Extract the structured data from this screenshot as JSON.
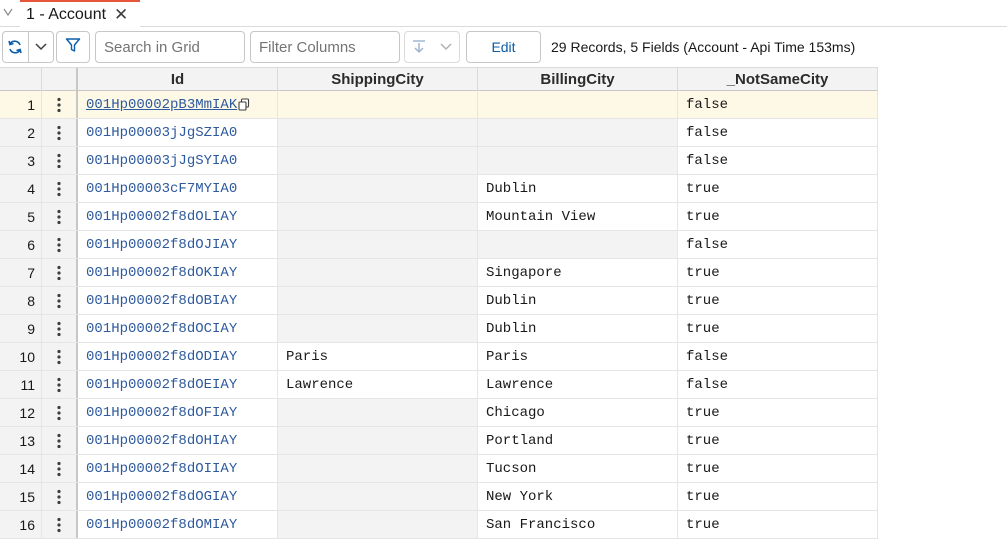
{
  "tabs": [
    {
      "label": "1 - Account",
      "close_glyph": "✕"
    }
  ],
  "toolbar": {
    "search_placeholder": "Search in Grid",
    "filter_placeholder": "Filter Columns",
    "edit_label": "Edit",
    "status": "29 Records, 5 Fields (Account - Api Time 153ms)"
  },
  "colors": {
    "accent": "#0b5cab",
    "tab_indicator": "#e8563a",
    "link": "#2e5a9e",
    "selected_row": "#fef9e6"
  },
  "icons": [
    "collapse-icon",
    "refresh-icon",
    "chevron-down-icon",
    "filter-icon",
    "export-icon",
    "row-menu-icon",
    "copy-icon",
    "close-icon"
  ],
  "grid": {
    "columns": [
      "",
      "",
      "Id",
      "ShippingCity",
      "BillingCity",
      "_NotSameCity"
    ],
    "rows": [
      {
        "num": "1",
        "id": "001Hp00002pB3MmIAK",
        "shipping": "",
        "billing": "",
        "not_same": "false"
      },
      {
        "num": "2",
        "id": "001Hp00003jJgSZIA0",
        "shipping": "",
        "billing": "",
        "not_same": "false"
      },
      {
        "num": "3",
        "id": "001Hp00003jJgSYIA0",
        "shipping": "",
        "billing": "",
        "not_same": "false"
      },
      {
        "num": "4",
        "id": "001Hp00003cF7MYIA0",
        "shipping": "",
        "billing": "Dublin",
        "not_same": "true"
      },
      {
        "num": "5",
        "id": "001Hp00002f8dOLIAY",
        "shipping": "",
        "billing": "Mountain View",
        "not_same": "true"
      },
      {
        "num": "6",
        "id": "001Hp00002f8dOJIAY",
        "shipping": "",
        "billing": "",
        "not_same": "false"
      },
      {
        "num": "7",
        "id": "001Hp00002f8dOKIAY",
        "shipping": "",
        "billing": "Singapore",
        "not_same": "true"
      },
      {
        "num": "8",
        "id": "001Hp00002f8dOBIAY",
        "shipping": "",
        "billing": "Dublin",
        "not_same": "true"
      },
      {
        "num": "9",
        "id": "001Hp00002f8dOCIAY",
        "shipping": "",
        "billing": "Dublin",
        "not_same": "true"
      },
      {
        "num": "10",
        "id": "001Hp00002f8dODIAY",
        "shipping": "Paris",
        "billing": "Paris",
        "not_same": "false"
      },
      {
        "num": "11",
        "id": "001Hp00002f8dOEIAY",
        "shipping": "Lawrence",
        "billing": "Lawrence",
        "not_same": "false"
      },
      {
        "num": "12",
        "id": "001Hp00002f8dOFIAY",
        "shipping": "",
        "billing": "Chicago",
        "not_same": "true"
      },
      {
        "num": "13",
        "id": "001Hp00002f8dOHIAY",
        "shipping": "",
        "billing": "Portland",
        "not_same": "true"
      },
      {
        "num": "14",
        "id": "001Hp00002f8dOIIAY",
        "shipping": "",
        "billing": "Tucson",
        "not_same": "true"
      },
      {
        "num": "15",
        "id": "001Hp00002f8dOGIAY",
        "shipping": "",
        "billing": "New York",
        "not_same": "true"
      },
      {
        "num": "16",
        "id": "001Hp00002f8dOMIAY",
        "shipping": "",
        "billing": "San Francisco",
        "not_same": "true"
      }
    ]
  }
}
